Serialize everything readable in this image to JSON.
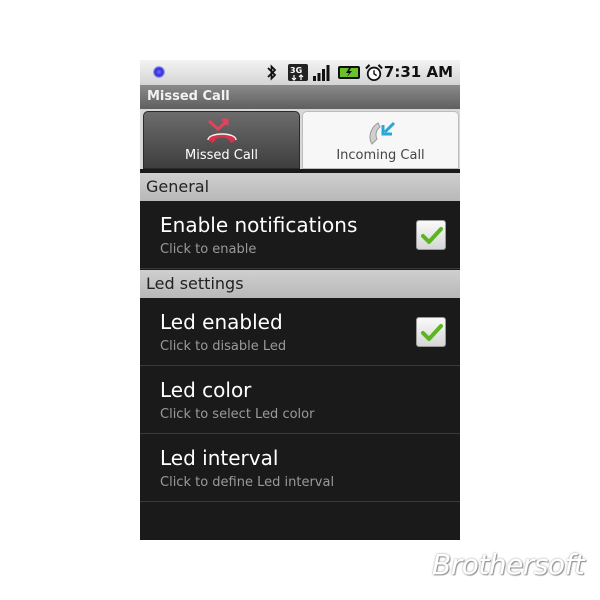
{
  "status_bar": {
    "time": "7:31 AM",
    "icons": [
      "notification-dot-icon",
      "bluetooth-icon",
      "3g-icon",
      "signal-icon",
      "battery-icon",
      "alarm-icon"
    ],
    "network_label": "3G"
  },
  "title_bar": {
    "title": "Missed Call"
  },
  "tabs": [
    {
      "label": "Missed Call",
      "icon": "missed-call-icon",
      "selected": true
    },
    {
      "label": "Incoming Call",
      "icon": "incoming-call-icon",
      "selected": false
    }
  ],
  "sections": {
    "general": {
      "header": "General",
      "enable_notifications": {
        "title": "Enable notifications",
        "summary": "Click to enable",
        "checked": true
      }
    },
    "led": {
      "header": "Led settings",
      "led_enabled": {
        "title": "Led enabled",
        "summary": "Click to disable Led",
        "checked": true
      },
      "led_color": {
        "title": "Led color",
        "summary": "Click to select Led color"
      },
      "led_interval": {
        "title": "Led interval",
        "summary": "Click to define Led interval"
      }
    }
  },
  "watermark": {
    "text": "Brothersoft"
  },
  "colors": {
    "background": "#1a1a1a",
    "check_green": "#5bb520",
    "missed_red": "#d8334a",
    "incoming_blue": "#2aa7d6"
  }
}
